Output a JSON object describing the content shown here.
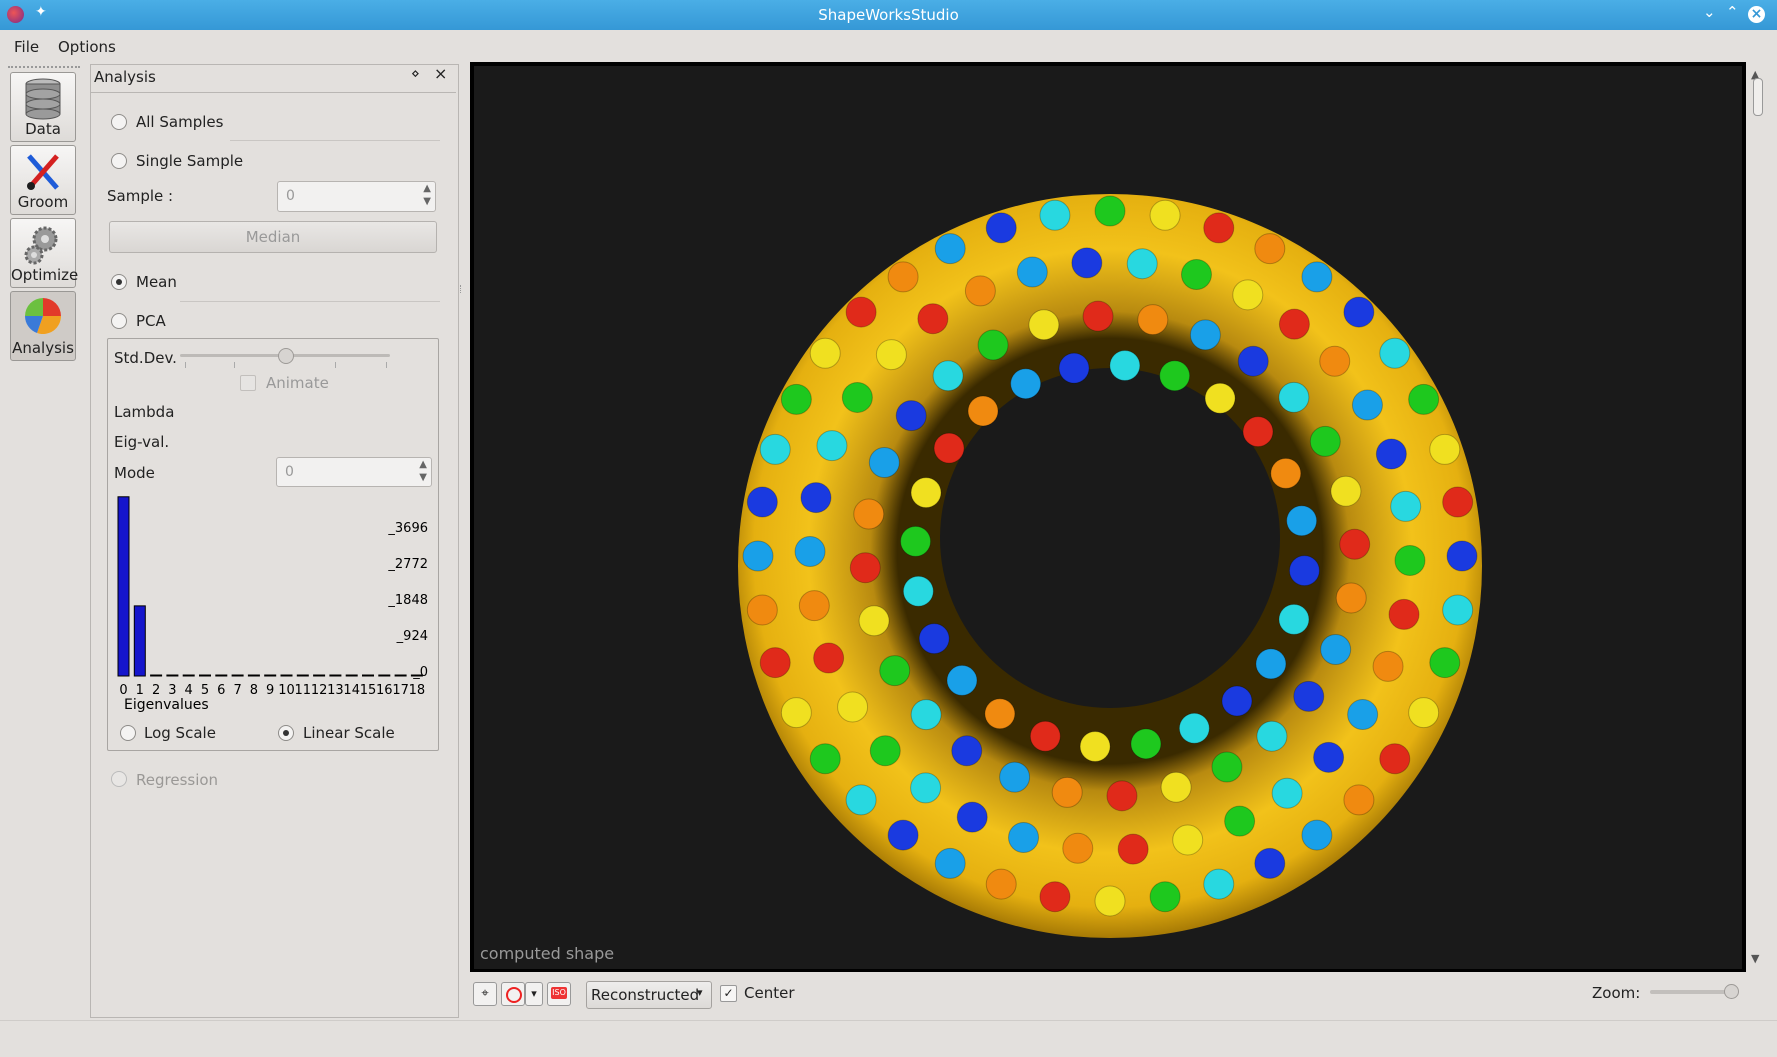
{
  "window": {
    "title": "ShapeWorksStudio"
  },
  "menu": {
    "file": "File",
    "options": "Options"
  },
  "tools": [
    {
      "label": "Data",
      "icon": "database-icon"
    },
    {
      "label": "Groom",
      "icon": "tools-icon"
    },
    {
      "label": "Optimize",
      "icon": "gears-icon"
    },
    {
      "label": "Analysis",
      "icon": "pie-chart-icon"
    }
  ],
  "panel": {
    "title": "Analysis",
    "float_glyph": "⋄",
    "close_glyph": "×",
    "all_samples": "All Samples",
    "single_sample": "Single Sample",
    "sample_label": "Sample :",
    "sample_value": "0",
    "median": "Median",
    "mean": "Mean",
    "pca": "PCA",
    "std_dev": "Std.Dev.",
    "animate": "Animate",
    "lambda": "Lambda",
    "eig_val": "Eig-val.",
    "mode_label": "Mode",
    "mode_value": "0",
    "log_scale": "Log Scale",
    "linear_scale": "Linear Scale",
    "regression": "Regression",
    "selected_mode": "Mean",
    "selected_scale": "Linear Scale"
  },
  "chart_data": {
    "type": "bar",
    "xlabel": "Eigenvalues",
    "categories": [
      "0",
      "1",
      "2",
      "3",
      "4",
      "5",
      "6",
      "7",
      "8",
      "9",
      "10",
      "11",
      "12",
      "13",
      "14",
      "15",
      "16",
      "17",
      "18"
    ],
    "values": [
      4600,
      1800,
      0,
      0,
      0,
      0,
      0,
      0,
      0,
      0,
      0,
      0,
      0,
      0,
      0,
      0,
      0,
      0,
      0
    ],
    "ticks": [
      "_3696",
      "_2772",
      "_1848",
      "_924",
      "_0"
    ],
    "tick_values": [
      3696,
      2772,
      1848,
      924,
      0
    ],
    "ylim": [
      0,
      4620
    ]
  },
  "viewer": {
    "overlay": "computed shape",
    "display_mode": "Reconstructed",
    "center_label": "Center",
    "center_checked": true,
    "zoom_label": "Zoom:",
    "iso_label": "ISO"
  }
}
